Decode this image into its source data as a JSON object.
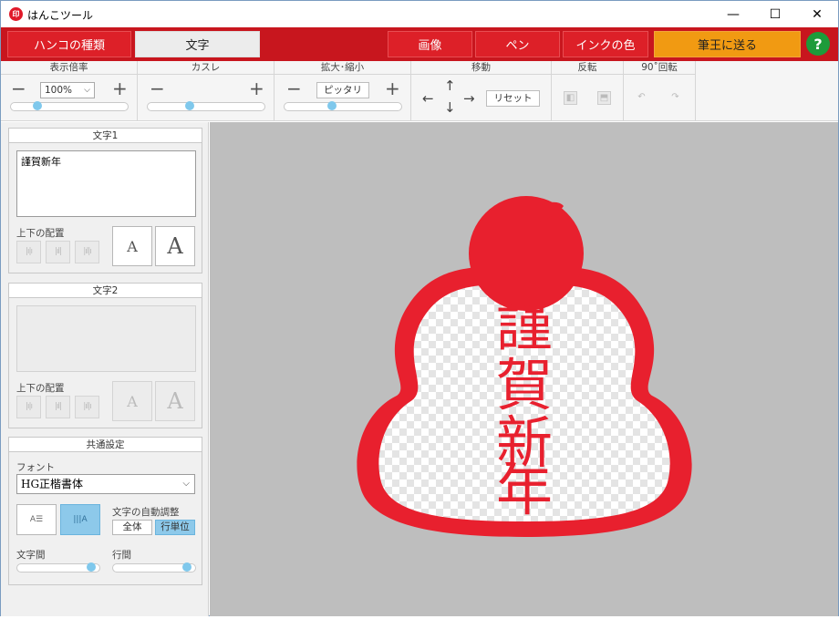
{
  "window": {
    "title": "はんこツール",
    "app_icon_text": "印",
    "minimize_glyph": "—",
    "maximize_glyph": "☐",
    "close_glyph": "✕"
  },
  "tabs": [
    {
      "label": "ハンコの種類"
    },
    {
      "label": "文字",
      "active": true
    },
    {
      "label": "画像"
    },
    {
      "label": "ペン"
    },
    {
      "label": "インクの色"
    }
  ],
  "send_button": "筆王に送る",
  "help_button": "?",
  "toolbar": {
    "zoom": {
      "label": "表示倍率",
      "value": "100%",
      "slider": 0.2
    },
    "kasure": {
      "label": "カスレ",
      "slider": 0.35
    },
    "scale": {
      "label": "拡大･縮小",
      "fit_label": "ピッタリ",
      "slider": 0.4
    },
    "move": {
      "label": "移動",
      "reset_label": "リセット"
    },
    "flip": {
      "label": "反転"
    },
    "rotate": {
      "label": "90˚回転"
    },
    "minus": "−",
    "plus": "+"
  },
  "text1": {
    "title": "文字1",
    "value": "謹賀新年",
    "align_label": "上下の配置",
    "font_small": "A",
    "font_large": "A"
  },
  "text2": {
    "title": "文字2",
    "value": "",
    "align_label": "上下の配置",
    "font_small": "A",
    "font_large": "A"
  },
  "common": {
    "title": "共通設定",
    "font_label": "フォント",
    "font_value": "HG正楷書体",
    "auto_adjust_label": "文字の自動調整",
    "auto_all": "全体",
    "auto_line": "行単位",
    "char_spacing_label": "文字間",
    "char_spacing": 0.95,
    "line_spacing_label": "行間",
    "line_spacing": 0.95
  },
  "stamp": {
    "text": "謹賀新年",
    "ink_color": "#e8202e"
  }
}
